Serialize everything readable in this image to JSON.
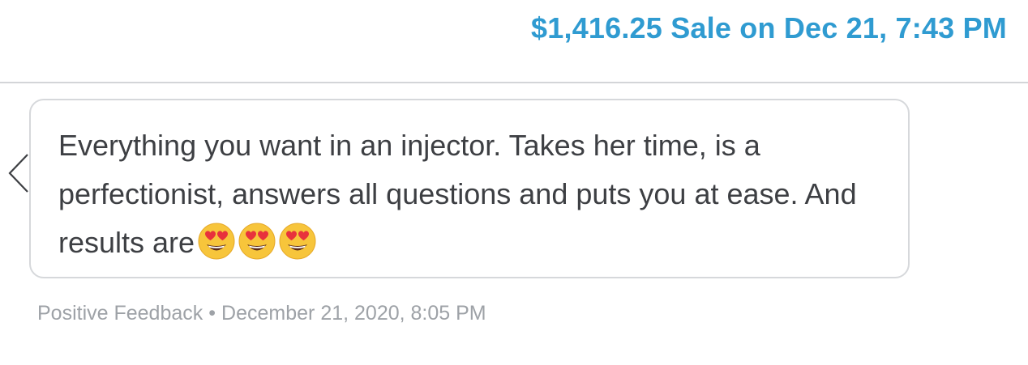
{
  "header": {
    "sale_link": "$1,416.25 Sale on Dec 21, 7:43 PM"
  },
  "nav": {
    "back_icon": "chevron-left-icon"
  },
  "feedback": {
    "message_text": "Everything you want in an injector. Takes her time, is a perfectionist, answers all questions and puts you at ease. And results are",
    "emojis": [
      "heart-eyes-emoji",
      "heart-eyes-emoji",
      "heart-eyes-emoji"
    ],
    "type_label": "Positive Feedback",
    "separator": "•",
    "timestamp": "December 21, 2020, 8:05 PM"
  },
  "colors": {
    "link": "#2f9bd1",
    "text": "#3d3f43",
    "muted": "#9ea2a7",
    "border": "#d6d8db"
  }
}
